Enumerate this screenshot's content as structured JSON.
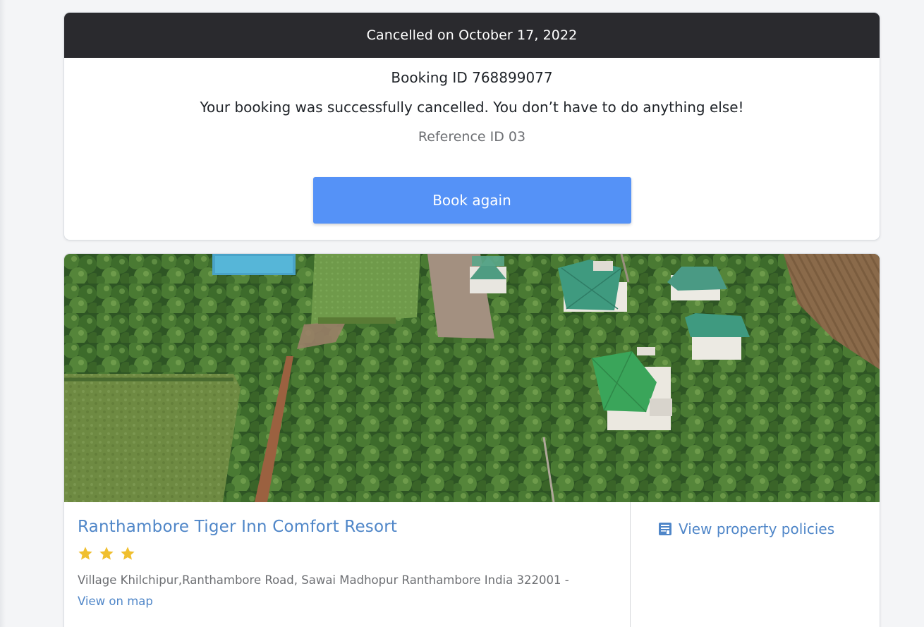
{
  "cancellation": {
    "header": "Cancelled on October 17, 2022",
    "booking_id": "Booking ID 768899077",
    "message": "Your booking was successfully cancelled. You don’t have to do anything else!",
    "reference_id": "Reference ID 03",
    "book_again_label": "Book again"
  },
  "property": {
    "name": "Ranthambore Tiger Inn Comfort Resort",
    "star_rating": 3,
    "address": "Village Khilchipur,Ranthambore Road, Sawai Madhopur Ranthambore India 322001 -",
    "map_link_label": "View on map",
    "policies_label": "View property policies",
    "policies_icon": "pdf-document-icon",
    "photo": "aerial-resort-photo"
  },
  "colors": {
    "header_bg": "#2a2a2e",
    "button_blue": "#5592f7",
    "link_blue": "#4f86c8",
    "star_gold": "#f0bf2e"
  }
}
